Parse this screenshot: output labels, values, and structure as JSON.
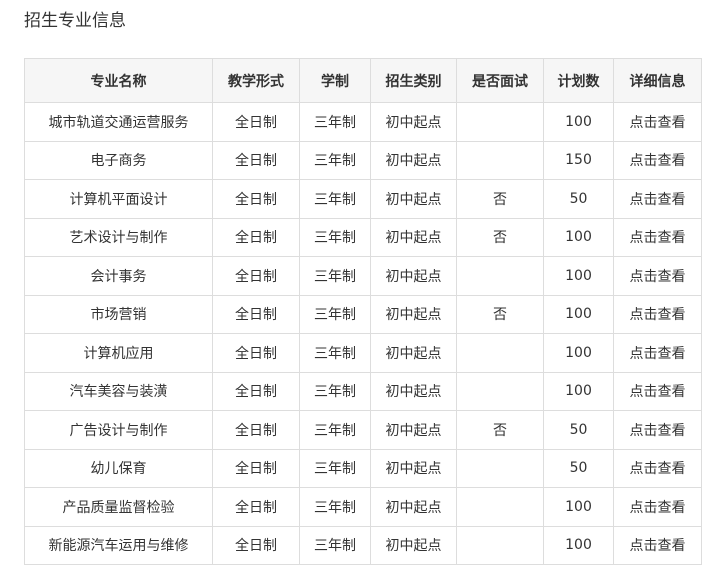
{
  "page": {
    "title": "招生专业信息"
  },
  "table": {
    "headers": [
      "专业名称",
      "教学形式",
      "学制",
      "招生类别",
      "是否面试",
      "计划数",
      "详细信息"
    ],
    "rows": [
      [
        "城市轨道交通运营服务",
        "全日制",
        "三年制",
        "初中起点",
        "",
        "100",
        "点击查看"
      ],
      [
        "电子商务",
        "全日制",
        "三年制",
        "初中起点",
        "",
        "150",
        "点击查看"
      ],
      [
        "计算机平面设计",
        "全日制",
        "三年制",
        "初中起点",
        "否",
        "50",
        "点击查看"
      ],
      [
        "艺术设计与制作",
        "全日制",
        "三年制",
        "初中起点",
        "否",
        "100",
        "点击查看"
      ],
      [
        "会计事务",
        "全日制",
        "三年制",
        "初中起点",
        "",
        "100",
        "点击查看"
      ],
      [
        "市场营销",
        "全日制",
        "三年制",
        "初中起点",
        "否",
        "100",
        "点击查看"
      ],
      [
        "计算机应用",
        "全日制",
        "三年制",
        "初中起点",
        "",
        "100",
        "点击查看"
      ],
      [
        "汽车美容与装潢",
        "全日制",
        "三年制",
        "初中起点",
        "",
        "100",
        "点击查看"
      ],
      [
        "广告设计与制作",
        "全日制",
        "三年制",
        "初中起点",
        "否",
        "50",
        "点击查看"
      ],
      [
        "幼儿保育",
        "全日制",
        "三年制",
        "初中起点",
        "",
        "50",
        "点击查看"
      ],
      [
        "产品质量监督检验",
        "全日制",
        "三年制",
        "初中起点",
        "",
        "100",
        "点击查看"
      ],
      [
        "新能源汽车运用与维修",
        "全日制",
        "三年制",
        "初中起点",
        "",
        "100",
        "点击查看"
      ]
    ]
  }
}
